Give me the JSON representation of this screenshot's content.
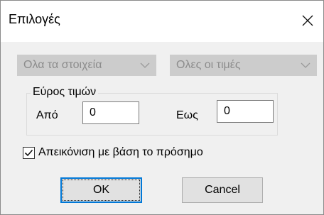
{
  "dialog": {
    "title": "Επιλογές",
    "close_icon": "close-icon"
  },
  "filters": {
    "items_dropdown": {
      "selected": "Ολα τα στοιχεία",
      "enabled": false
    },
    "values_dropdown": {
      "selected": "Ολες οι τιμές",
      "enabled": false
    }
  },
  "value_range": {
    "group_label": "Εύρος τιμών",
    "from_label": "Από",
    "from_value": "0",
    "to_label": "Εως",
    "to_value": "0"
  },
  "sign_option": {
    "label": "Απεικόνιση με βάση το πρόσημο",
    "checked": true
  },
  "buttons": {
    "ok": "OK",
    "cancel": "Cancel"
  },
  "colors": {
    "accent": "#0078d7",
    "disabled_fill": "#cccccc",
    "disabled_text": "#8c8c8c"
  }
}
